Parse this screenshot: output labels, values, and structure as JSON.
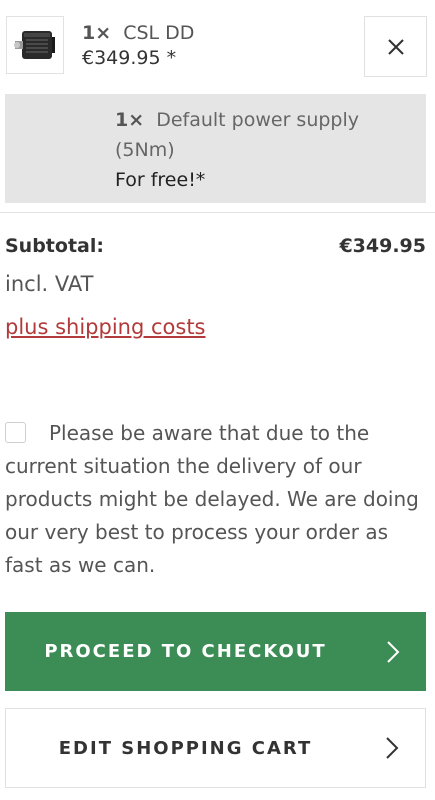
{
  "cart_item": {
    "quantity": "1×",
    "name": "CSL DD",
    "price": "€349.95 *",
    "thumbnail_icon": "wheel-base-product-icon",
    "remove_icon": "close-icon"
  },
  "bundle": {
    "quantity": "1×",
    "name_line1": "Default power supply",
    "name_line2": "(5Nm)",
    "price": "For free!*"
  },
  "summary": {
    "subtotal_label": "Subtotal:",
    "subtotal_value": "€349.95",
    "vat": "incl. VAT",
    "shipping_link": "plus shipping costs"
  },
  "notice": {
    "text": "Please be aware that due to the current situation the delivery of our products might be delayed. We are doing our very best to process your order as fast as we can.",
    "checked": false
  },
  "actions": {
    "checkout_label": "PROCEED TO CHECKOUT",
    "edit_label": "EDIT SHOPPING CART",
    "arrow_icon": "chevron-right-icon"
  },
  "colors": {
    "checkout_button": "#3c8c55",
    "link": "#b23a3a",
    "bundle_background": "#e5e5e5"
  }
}
